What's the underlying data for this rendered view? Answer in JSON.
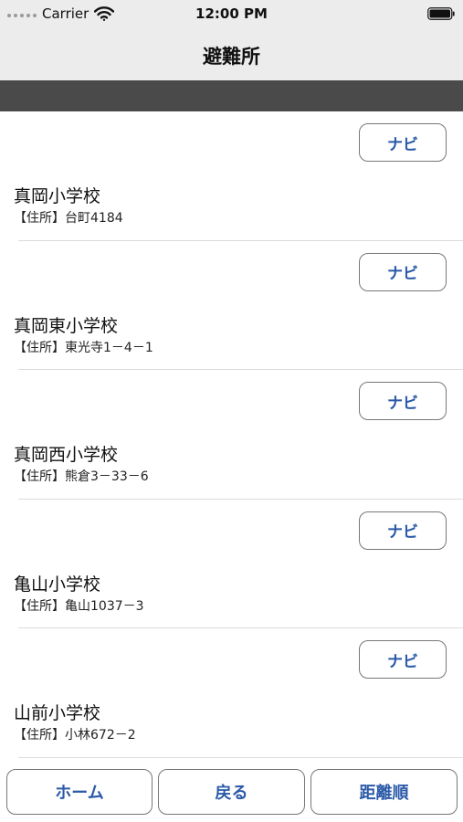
{
  "status_bar": {
    "carrier": "Carrier",
    "time": "12:00 PM"
  },
  "header": {
    "title": "避難所"
  },
  "shelters": [
    {
      "name": "真岡小学校",
      "address": "【住所】台町4184",
      "button": "ナビ"
    },
    {
      "name": "真岡東小学校",
      "address": "【住所】東光寺1－4－1",
      "button": "ナビ"
    },
    {
      "name": "真岡西小学校",
      "address": "【住所】熊倉3－33－6",
      "button": "ナビ"
    },
    {
      "name": "亀山小学校",
      "address": "【住所】亀山1037－3",
      "button": "ナビ"
    },
    {
      "name": "山前小学校",
      "address": "【住所】小林672－2",
      "button": "ナビ"
    }
  ],
  "toolbar": {
    "home_label": "ホーム",
    "back_label": "戻る",
    "distance_label": "距離順"
  },
  "colors": {
    "bar_background": "#ececec",
    "band": "#4a4a4a",
    "button_text": "#2b5aa8"
  },
  "icons": [
    "signal-icon",
    "wifi-icon",
    "battery-icon"
  ]
}
